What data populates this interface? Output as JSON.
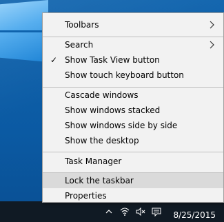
{
  "menu": {
    "items": [
      {
        "label": "Toolbars",
        "submenu": true
      },
      {
        "label": "Search",
        "submenu": true
      },
      {
        "label": "Show Task View button",
        "checked": true
      },
      {
        "label": "Show touch keyboard button"
      },
      {
        "label": "Cascade windows"
      },
      {
        "label": "Show windows stacked"
      },
      {
        "label": "Show windows side by side"
      },
      {
        "label": "Show the desktop"
      },
      {
        "label": "Task Manager"
      },
      {
        "label": "Lock the taskbar",
        "highlighted": true
      },
      {
        "label": "Properties"
      }
    ],
    "check_glyph": "✓",
    "highlight_color": "#dadada"
  },
  "taskbar": {
    "clock": "8/25/2015",
    "tray_icons": [
      "chevron-up-icon",
      "wifi-icon",
      "speaker-muted-icon",
      "notification-icon"
    ]
  }
}
